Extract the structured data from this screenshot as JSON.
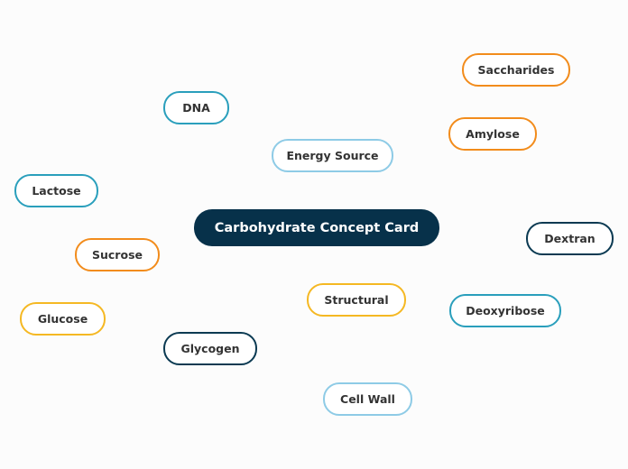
{
  "central_topic": {
    "label": "Carbohydrate Concept Card",
    "fill_color": "#07314a",
    "text_color": "#ffffff"
  },
  "palette": {
    "orange": "#f28c1c",
    "teal": "#2a9fbc",
    "light_blue": "#8ecbe6",
    "yellow": "#f5b823",
    "navy": "#0b3a52"
  },
  "topics": [
    {
      "id": "saccharides",
      "label": "Saccharides",
      "color": "orange"
    },
    {
      "id": "amylose",
      "label": "Amylose",
      "color": "orange"
    },
    {
      "id": "dna",
      "label": "DNA",
      "color": "teal"
    },
    {
      "id": "energy-source",
      "label": "Energy Source",
      "color": "light_blue"
    },
    {
      "id": "lactose",
      "label": "Lactose",
      "color": "teal"
    },
    {
      "id": "sucrose",
      "label": "Sucrose",
      "color": "orange"
    },
    {
      "id": "glucose",
      "label": "Glucose",
      "color": "yellow"
    },
    {
      "id": "structural",
      "label": "Structural",
      "color": "yellow"
    },
    {
      "id": "glycogen",
      "label": "Glycogen",
      "color": "navy"
    },
    {
      "id": "cell-wall",
      "label": "Cell Wall",
      "color": "light_blue"
    },
    {
      "id": "dextran",
      "label": "Dextran",
      "color": "navy"
    },
    {
      "id": "deoxyribose",
      "label": "Deoxyribose",
      "color": "teal"
    }
  ]
}
